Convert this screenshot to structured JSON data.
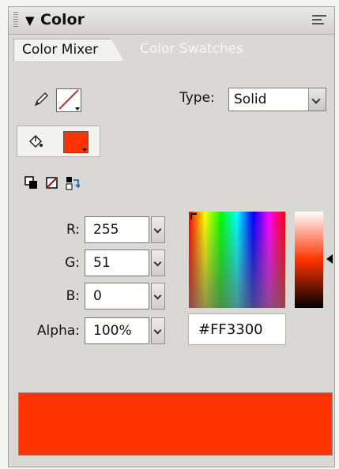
{
  "panel": {
    "title": "Color",
    "tabs": [
      {
        "label": "Color Mixer",
        "active": true
      },
      {
        "label": "Color Swatches",
        "active": false
      }
    ],
    "icons": {
      "grip": "gripper-icon",
      "collapse": "collapse-arrow-icon",
      "options": "panel-options-icon"
    }
  },
  "mixer": {
    "type_label": "Type:",
    "type_value": "Solid",
    "stroke_color": "#e0201f",
    "fill_color": "#ff3300",
    "fields": [
      {
        "label": "R:",
        "value": "255"
      },
      {
        "label": "G:",
        "value": "51"
      },
      {
        "label": "B:",
        "value": "0"
      },
      {
        "label": "Alpha:",
        "value": "100%"
      }
    ],
    "hex_value": "#FF3300",
    "preview_color": "#ff3300"
  }
}
